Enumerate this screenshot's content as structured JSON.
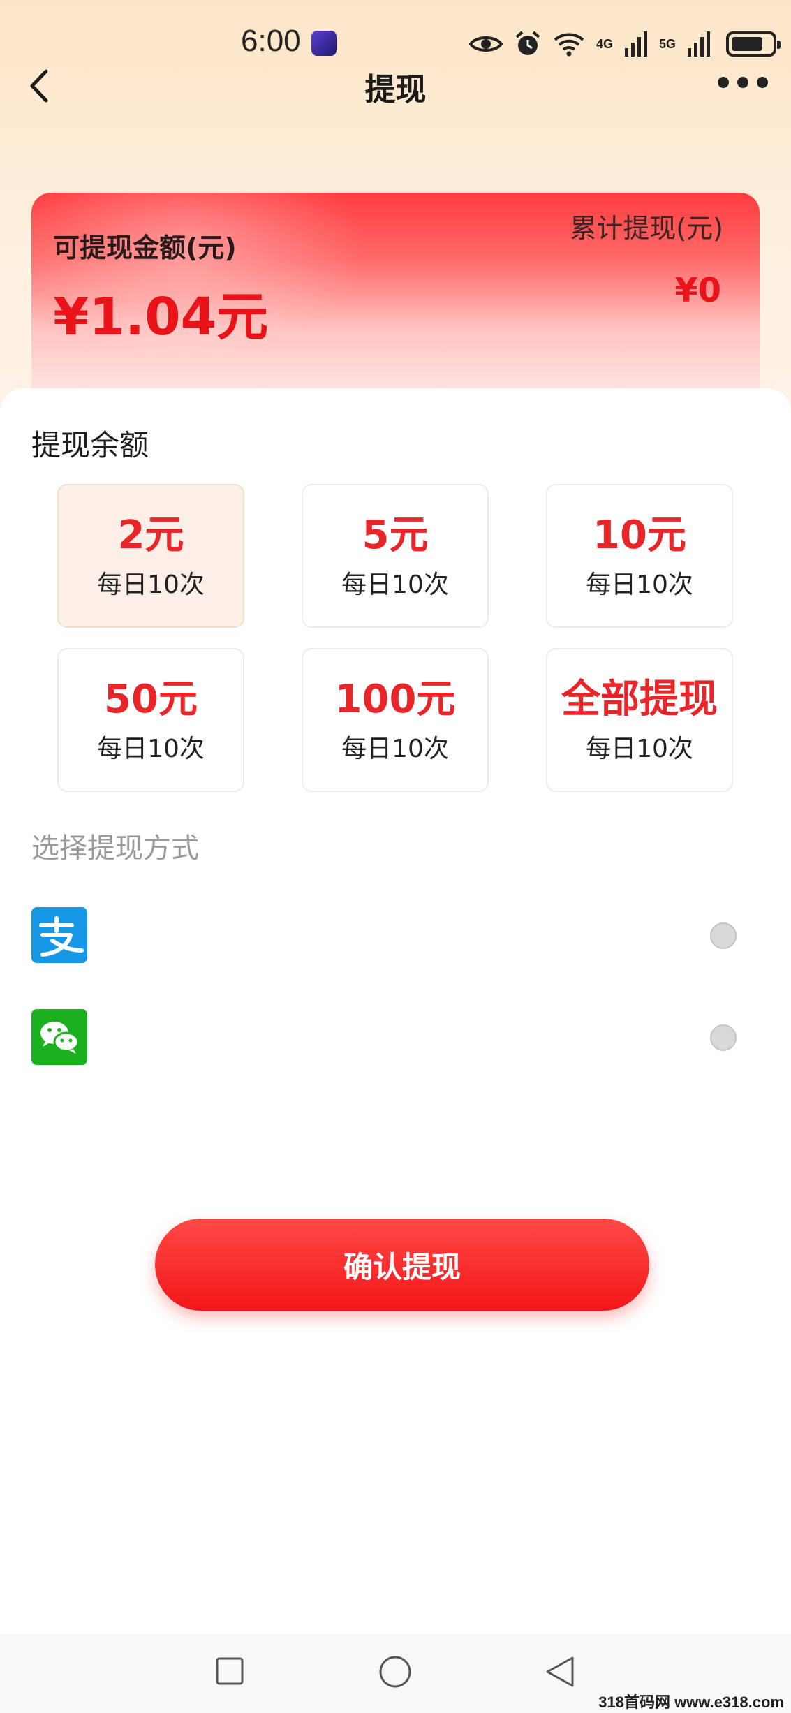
{
  "status_bar": {
    "time": "6:00",
    "network_1": "4G",
    "network_2": "5G",
    "battery_level": 0.78
  },
  "header": {
    "title": "提现"
  },
  "balance_card": {
    "available_label": "可提现金额(元)",
    "available_amount": "¥1.04元",
    "total_label": "累计提现(元)",
    "total_amount": "¥0"
  },
  "withdraw": {
    "section_title": "提现余额",
    "options": [
      {
        "amount": "2元",
        "limit": "每日10次",
        "selected": true
      },
      {
        "amount": "5元",
        "limit": "每日10次",
        "selected": false
      },
      {
        "amount": "10元",
        "limit": "每日10次",
        "selected": false
      },
      {
        "amount": "50元",
        "limit": "每日10次",
        "selected": false
      },
      {
        "amount": "100元",
        "limit": "每日10次",
        "selected": false
      },
      {
        "amount": "全部提现",
        "limit": "每日10次",
        "selected": false
      }
    ]
  },
  "payment": {
    "section_title": "选择提现方式",
    "methods": [
      {
        "icon": "alipay-icon",
        "selected": false
      },
      {
        "icon": "wechat-icon",
        "selected": false
      }
    ]
  },
  "confirm_button": {
    "label": "确认提现"
  },
  "watermark": "318首码网 www.e318.com",
  "colors": {
    "accent": "#e8262a",
    "button": "#f2161a",
    "alipay": "#1597e5",
    "wechat": "#1bb01d"
  }
}
